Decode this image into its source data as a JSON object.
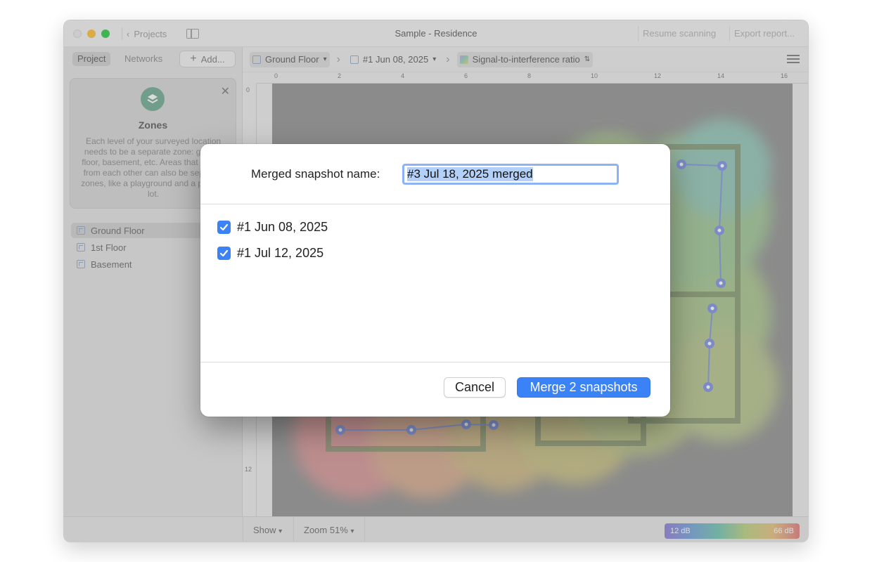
{
  "window": {
    "title": "Sample - Residence",
    "back_label": "Projects",
    "resume_label": "Resume scanning",
    "export_label": "Export report..."
  },
  "sidebar": {
    "tabs": [
      "Project",
      "Networks"
    ],
    "add_label": "Add...",
    "zones_card": {
      "title": "Zones",
      "description": "Each level of your surveyed location needs to be a separate zone: ground floor, basement, etc. Areas that are far from each other can also be separate zones, like a playground and a parking lot."
    },
    "zones": [
      "Ground Floor",
      "1st Floor",
      "Basement"
    ]
  },
  "breadcrumbs": {
    "zone": "Ground Floor",
    "snapshot": "#1 Jun 08, 2025",
    "visualization": "Signal-to-interference ratio"
  },
  "ruler": {
    "top_ticks": [
      "0",
      "2",
      "4",
      "6",
      "8",
      "10",
      "12",
      "14",
      "16"
    ],
    "left_ticks": [
      "0",
      "12"
    ]
  },
  "bottombar": {
    "show_label": "Show",
    "zoom_label": "Zoom 51%",
    "legend_min": "12 dB",
    "legend_max": "66 dB"
  },
  "dialog": {
    "name_label": "Merged snapshot name:",
    "name_value": "#3 Jul 18, 2025 merged",
    "snapshots": [
      {
        "label": "#1 Jun 08, 2025",
        "checked": true
      },
      {
        "label": "#1 Jul 12, 2025",
        "checked": true
      }
    ],
    "cancel_label": "Cancel",
    "merge_label": "Merge 2 snapshots"
  },
  "colors": {
    "accent": "#3b82f6",
    "input_focus": "#8db3f4",
    "selection": "#b3d1f8"
  }
}
